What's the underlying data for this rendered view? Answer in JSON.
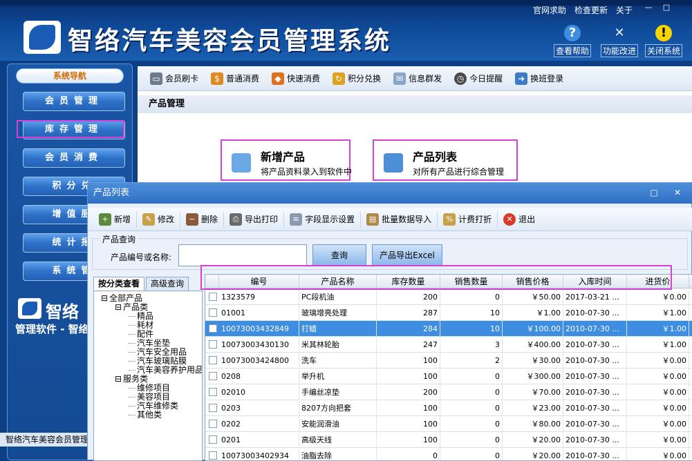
{
  "header": {
    "title": "智络汽车美容会员管理系统",
    "top_links": [
      "官网求助",
      "检查更新",
      "关于"
    ],
    "window_controls": [
      "—",
      "□"
    ],
    "buttons": [
      {
        "label": "查看帮助",
        "icon": "help-icon"
      },
      {
        "label": "功能改进",
        "icon": "tools-icon"
      },
      {
        "label": "关闭系统",
        "icon": "warning-icon"
      }
    ]
  },
  "sidebar": {
    "heading": "系统导航",
    "items": [
      "会员管理",
      "库存管理",
      "会员消费",
      "积分兑",
      "增值服",
      "统计报",
      "系统管"
    ],
    "logo_text": "智络",
    "slogan": "管理软件 - 智络",
    "status_text": "智络汽车美容会员管理"
  },
  "toolbar": {
    "items": [
      {
        "label": "会员刷卡",
        "icon": "card-icon"
      },
      {
        "label": "普通消费",
        "icon": "coin-icon"
      },
      {
        "label": "快速消费",
        "icon": "bag-icon"
      },
      {
        "label": "积分兑换",
        "icon": "exchange-icon"
      },
      {
        "label": "信息群发",
        "icon": "mail-icon"
      },
      {
        "label": "今日提醒",
        "icon": "clock-icon"
      },
      {
        "label": "换班登录",
        "icon": "shift-icon"
      }
    ]
  },
  "main": {
    "section_title": "产品管理",
    "cards": [
      {
        "title": "新增产品",
        "subtitle": "将产品资料录入到软件中"
      },
      {
        "title": "产品列表",
        "subtitle": "对所有产品进行综合管理"
      }
    ]
  },
  "dialog": {
    "title": "产品列表",
    "controls": [
      "□",
      "✕"
    ],
    "toolbar": [
      {
        "label": "新增",
        "icon": "add-icon"
      },
      {
        "label": "修改",
        "icon": "edit-icon"
      },
      {
        "label": "删除",
        "icon": "delete-icon"
      },
      {
        "label": "导出打印",
        "icon": "print-icon"
      },
      {
        "label": "字段显示设置",
        "icon": "fields-icon"
      },
      {
        "label": "批量数据导入",
        "icon": "import-icon"
      },
      {
        "label": "计费打折",
        "icon": "discount-icon"
      },
      {
        "label": "退出",
        "icon": "exit-icon"
      }
    ],
    "query": {
      "title": "产品查询",
      "label": "产品编号或名称:",
      "value": "",
      "search_button": "查询",
      "export_button": "产品导出Excel"
    },
    "tabs": [
      "按分类查看",
      "高级查询"
    ],
    "tree": [
      {
        "label": "全部产品",
        "level": 0,
        "toggle": "⊟"
      },
      {
        "label": "产品类",
        "level": 1,
        "toggle": "⊟"
      },
      {
        "label": "精品",
        "level": 2,
        "toggle": ""
      },
      {
        "label": "耗材",
        "level": 2,
        "toggle": ""
      },
      {
        "label": "配件",
        "level": 2,
        "toggle": ""
      },
      {
        "label": "汽车坐垫",
        "level": 2,
        "toggle": ""
      },
      {
        "label": "汽车安全用品",
        "level": 2,
        "toggle": ""
      },
      {
        "label": "汽车玻璃贴膜",
        "level": 2,
        "toggle": ""
      },
      {
        "label": "汽车美容养护用品",
        "level": 2,
        "toggle": ""
      },
      {
        "label": "服务类",
        "level": 1,
        "toggle": "⊟"
      },
      {
        "label": "维修项目",
        "level": 2,
        "toggle": ""
      },
      {
        "label": "美容项目",
        "level": 2,
        "toggle": ""
      },
      {
        "label": "汽车维修类",
        "level": 2,
        "toggle": ""
      },
      {
        "label": "其他类",
        "level": 2,
        "toggle": ""
      }
    ],
    "columns": [
      "编号",
      "产品名称",
      "库存数量",
      "销售数量",
      "销售价格",
      "入库时间",
      "进货价"
    ],
    "rows": [
      [
        "1323579",
        "PC段机油",
        "200",
        "0",
        "￥50.00",
        "2017-03-21 ...",
        "￥0.00"
      ],
      [
        "01001",
        "玻璃增亮处理",
        "287",
        "10",
        "￥1.00",
        "2010-07-30 ...",
        "￥1.00"
      ],
      [
        "10073003432849",
        "打蜡",
        "284",
        "10",
        "￥100.00",
        "2010-07-30 ...",
        "￥1.00"
      ],
      [
        "10073003430130",
        "米其林轮胎",
        "247",
        "3",
        "￥400.00",
        "2010-07-30 ...",
        "￥1.00"
      ],
      [
        "10073003424800",
        "洗车",
        "100",
        "2",
        "￥30.00",
        "2010-07-30 ...",
        "￥0.00"
      ],
      [
        "0208",
        "举升机",
        "100",
        "0",
        "￥300.00",
        "2010-07-30 ...",
        "￥0.00"
      ],
      [
        "02010",
        "手编丝凉垫",
        "200",
        "0",
        "￥70.00",
        "2010-07-30 ...",
        "￥0.00"
      ],
      [
        "0203",
        "8207方向把套",
        "100",
        "0",
        "￥23.00",
        "2010-07-30 ...",
        "￥0.00"
      ],
      [
        "0202",
        "安能润滑油",
        "100",
        "0",
        "￥80.00",
        "2010-07-30 ...",
        "￥0.00"
      ],
      [
        "0201",
        "高级天线",
        "100",
        "0",
        "￥20.00",
        "2010-07-30 ...",
        "￥0.00"
      ],
      [
        "10073003402934",
        "油脂去除",
        "0",
        "0",
        "￥20.00",
        "2010-07-30 ...",
        "￥0.00"
      ]
    ],
    "selected_row": 2
  }
}
